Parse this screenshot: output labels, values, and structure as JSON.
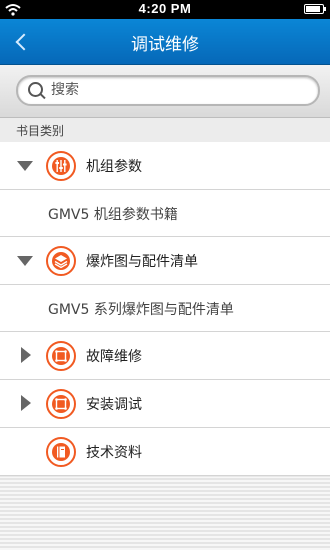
{
  "status_bar": {
    "time": "4:20 PM",
    "battery_level": 0.85
  },
  "nav": {
    "title": "调试维修"
  },
  "search": {
    "placeholder": "搜索"
  },
  "section_header": "书目类别",
  "categories": [
    {
      "label": "机组参数",
      "icon": "sliders-icon",
      "expanded": true,
      "children": [
        "GMV5 机组参数书籍"
      ]
    },
    {
      "label": "爆炸图与配件清单",
      "icon": "layers-icon",
      "expanded": true,
      "children": [
        "GMV5 系列爆炸图与配件清单"
      ]
    },
    {
      "label": "故障维修",
      "icon": "frame-icon",
      "expanded": false,
      "children": []
    },
    {
      "label": "安装调试",
      "icon": "frame-icon",
      "expanded": false,
      "children": []
    },
    {
      "label": "技术资料",
      "icon": "book-icon",
      "expanded": null,
      "children": []
    }
  ],
  "colors": {
    "nav_bar": "#0b78c8",
    "icon_accent": "#f15a22"
  }
}
